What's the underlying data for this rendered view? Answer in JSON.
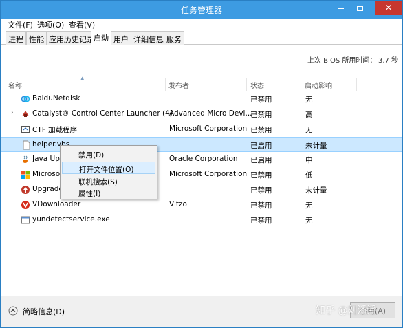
{
  "window": {
    "title": "任务管理器",
    "min_glyph": "—",
    "close_glyph": "✕"
  },
  "menubar": {
    "file": "文件(F)",
    "options": "选项(O)",
    "view": "查看(V)"
  },
  "tabs": [
    {
      "label": "进程",
      "active": false
    },
    {
      "label": "性能",
      "active": false
    },
    {
      "label": "应用历史记录",
      "active": false
    },
    {
      "label": "启动",
      "active": true
    },
    {
      "label": "用户",
      "active": false
    },
    {
      "label": "详细信息",
      "active": false
    },
    {
      "label": "服务",
      "active": false
    }
  ],
  "uptime": {
    "label": "上次 BIOS 所用时间：",
    "value": "3.7 秒"
  },
  "columns": {
    "name": "名称",
    "publisher": "发布者",
    "status": "状态",
    "impact": "启动影响"
  },
  "rows": [
    {
      "name": "BaiduNetdisk",
      "publisher": "",
      "status": "已禁用",
      "impact": "无",
      "icon": "baidu-netdisk-icon",
      "expandable": false
    },
    {
      "name": "Catalyst® Control Center Launcher (4)",
      "publisher": "Advanced Micro Devi...",
      "status": "已禁用",
      "impact": "高",
      "icon": "amd-catalyst-icon",
      "expandable": true
    },
    {
      "name": "CTF 加载程序",
      "publisher": "Microsoft Corporation",
      "status": "已禁用",
      "impact": "无",
      "icon": "ctf-loader-icon",
      "expandable": false
    },
    {
      "name": "helper.vbs",
      "publisher": "",
      "status": "已启用",
      "impact": "未计量",
      "icon": "script-file-icon",
      "expandable": false,
      "selected": true
    },
    {
      "name": "Java Upd",
      "publisher": "Oracle Corporation",
      "status": "已启用",
      "impact": "中",
      "icon": "java-icon",
      "expandable": false
    },
    {
      "name": "Microso",
      "publisher": "Microsoft Corporation",
      "status": "已禁用",
      "impact": "低",
      "icon": "microsoft-app-icon",
      "expandable": false
    },
    {
      "name": "Upgrade",
      "publisher": "",
      "status": "已禁用",
      "impact": "未计量",
      "icon": "upgrade-icon",
      "expandable": false
    },
    {
      "name": "VDownloader",
      "publisher": "Vitzo",
      "status": "已禁用",
      "impact": "无",
      "icon": "vdownloader-icon",
      "expandable": false
    },
    {
      "name": "yundetectservice.exe",
      "publisher": "",
      "status": "已禁用",
      "impact": "无",
      "icon": "exe-file-icon",
      "expandable": false
    }
  ],
  "context_menu": {
    "disable": "禁用(D)",
    "open_location": "打开文件位置(O)",
    "search_online": "联机搜索(S)",
    "properties": "属性(I)"
  },
  "footer": {
    "brief_info": "简略信息(D)",
    "disable_button": "禁用(A)"
  },
  "watermark": "知乎 @刘潘潘",
  "colors": {
    "titlebar": "#3d9be2",
    "selection": "#cce8ff",
    "close_button": "#c7372f"
  }
}
